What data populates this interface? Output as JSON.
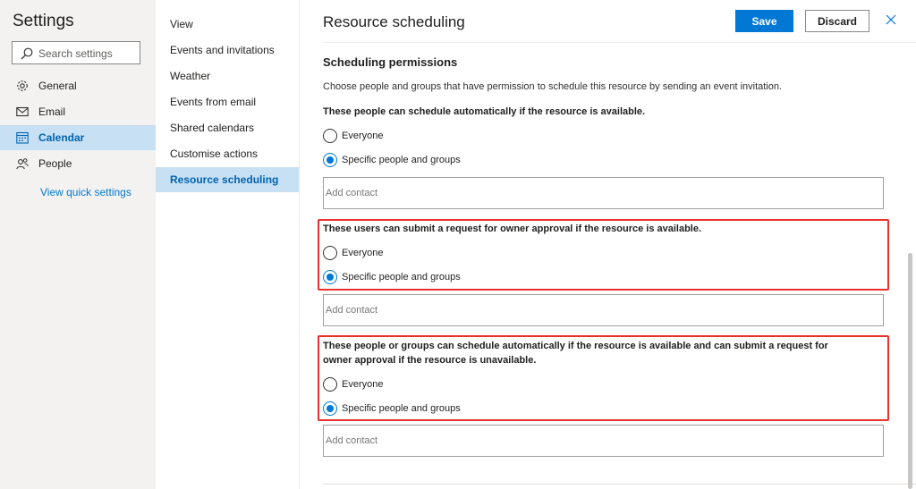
{
  "settings": {
    "title": "Settings",
    "search_placeholder": "Search settings",
    "nav": [
      {
        "label": "General",
        "icon": "gear-icon"
      },
      {
        "label": "Email",
        "icon": "mail-icon"
      },
      {
        "label": "Calendar",
        "icon": "calendar-icon",
        "active": true
      },
      {
        "label": "People",
        "icon": "people-icon"
      }
    ],
    "quick_settings": "View quick settings"
  },
  "categories": [
    {
      "label": "View"
    },
    {
      "label": "Events and invitations"
    },
    {
      "label": "Weather"
    },
    {
      "label": "Events from email"
    },
    {
      "label": "Shared calendars"
    },
    {
      "label": "Customise actions"
    },
    {
      "label": "Resource scheduling",
      "active": true
    }
  ],
  "content": {
    "title": "Resource scheduling",
    "save_label": "Save",
    "discard_label": "Discard",
    "close_icon": "close-icon",
    "section_title": "Scheduling permissions",
    "description": "Choose people and groups that have permission to schedule this resource by sending an event invitation.",
    "groups": [
      {
        "question": "These people can schedule automatically if the resource is available.",
        "options": [
          "Everyone",
          "Specific people and groups"
        ],
        "selected": "Specific people and groups",
        "contact_placeholder": "Add contact",
        "highlighted": false
      },
      {
        "question": "These users can submit a request for owner approval if the resource is available.",
        "options": [
          "Everyone",
          "Specific people and groups"
        ],
        "selected": "Specific people and groups",
        "contact_placeholder": "Add contact",
        "highlighted": true
      },
      {
        "question": "These people or groups can schedule automatically if the resource is available and can submit a request for owner approval if the resource is unavailable.",
        "options": [
          "Everyone",
          "Specific people and groups"
        ],
        "selected": "Specific people and groups",
        "contact_placeholder": "Add contact",
        "highlighted": true
      }
    ]
  },
  "colors": {
    "accent": "#0078d4",
    "active_nav_bg": "#c7e0f4",
    "highlight_border": "#e8322b",
    "left_pane_bg": "#f3f2f1"
  }
}
